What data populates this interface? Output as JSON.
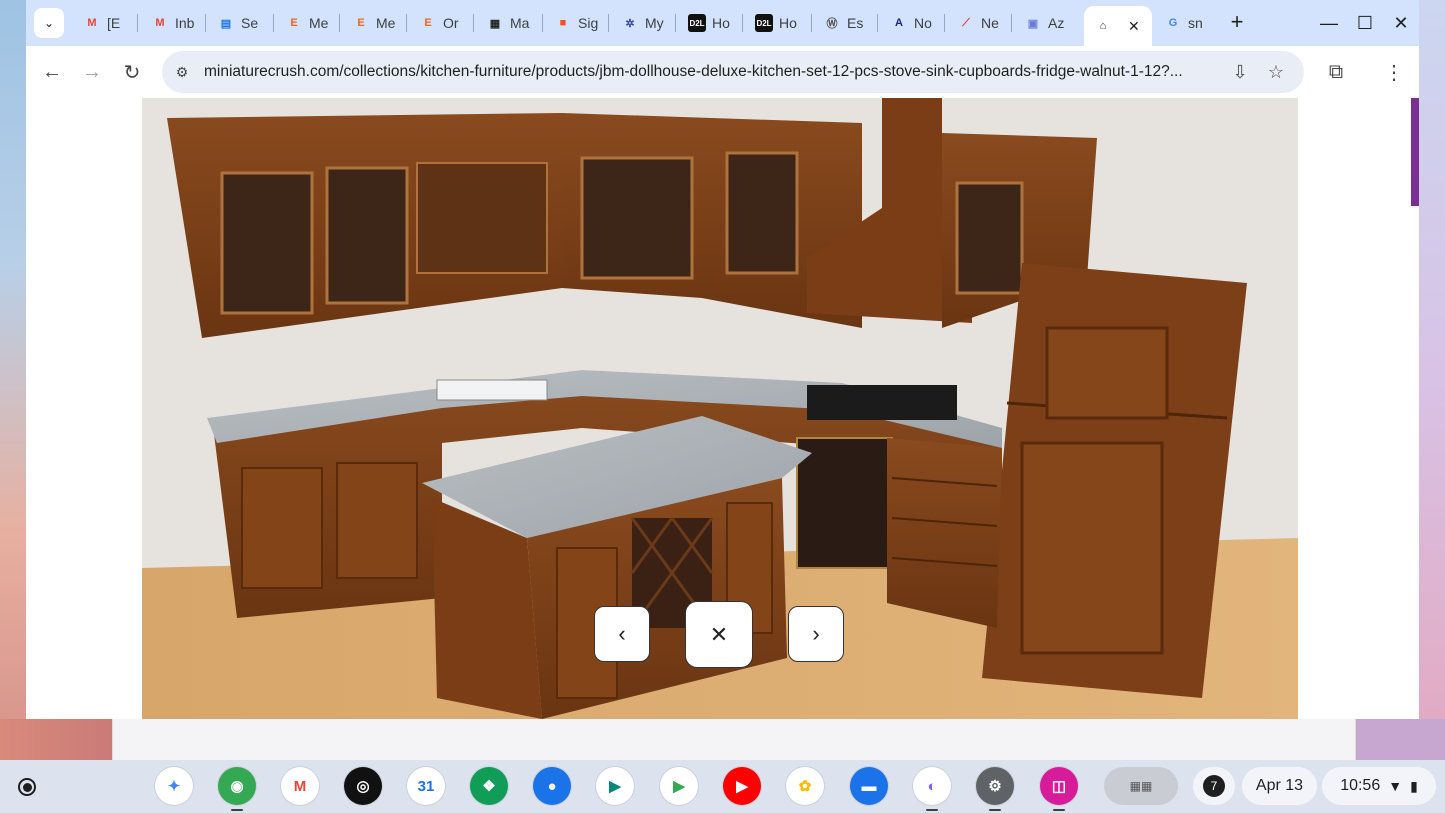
{
  "browser": {
    "tabs": [
      {
        "favicon": "gmail-icon",
        "label": "[E",
        "fav_color": "#ea4335"
      },
      {
        "favicon": "gmail-icon",
        "label": "Inb",
        "fav_color": "#ea4335"
      },
      {
        "favicon": "storefront-icon",
        "label": "Se",
        "fav_color": "#1a73e8"
      },
      {
        "favicon": "etsy-icon",
        "label": "Me",
        "fav_color": "#f1641e"
      },
      {
        "favicon": "etsy-icon",
        "label": "Me",
        "fav_color": "#f1641e"
      },
      {
        "favicon": "etsy-icon",
        "label": "Or",
        "fav_color": "#f1641e"
      },
      {
        "favicon": "colorful-store-icon",
        "label": "Ma",
        "fav_color": "#222222"
      },
      {
        "favicon": "microsoft-icon",
        "label": "Sig",
        "fav_color": "#f25022"
      },
      {
        "favicon": "pinwheel-icon",
        "label": "My",
        "fav_color": "#3949ab"
      },
      {
        "favicon": "d2l-icon",
        "label": "Ho",
        "fav_color": "#111111"
      },
      {
        "favicon": "d2l-icon",
        "label": "Ho",
        "fav_color": "#111111"
      },
      {
        "favicon": "signature-icon",
        "label": "Es",
        "fav_color": "#555555"
      },
      {
        "favicon": "letter-a-icon",
        "label": "No",
        "fav_color": "#1a237e"
      },
      {
        "favicon": "trend-icon",
        "label": "Ne",
        "fav_color": "#e53935"
      },
      {
        "favicon": "document-icon",
        "label": "Az",
        "fav_color": "#6b7dd8"
      },
      {
        "favicon": "house-icon",
        "label": "",
        "fav_color": "#333333",
        "active": true
      },
      {
        "favicon": "google-icon",
        "label": "sn",
        "fav_color": "#4285f4"
      }
    ],
    "fav_glyphs": [
      "M",
      "M",
      "▤",
      "E",
      "E",
      "E",
      "▦",
      "■",
      "✲",
      "D2L",
      "D2L",
      "Ⓦ",
      "A",
      "⟋",
      "▣",
      "⌂",
      "G"
    ],
    "new_tab": "+",
    "url": "miniaturecrush.com/collections/kitchen-furniture/products/jbm-dollhouse-deluxe-kitchen-set-12-pcs-stove-sink-cupboards-fridge-walnut-1-12?...",
    "accent": "#d3e3fd"
  },
  "gallery": {
    "prev": "‹",
    "close": "✕",
    "next": "›"
  },
  "shelf": {
    "apps": [
      {
        "name": "gemini-icon",
        "glyph": "✦",
        "bg": "#ffffff",
        "fg": "#4285f4"
      },
      {
        "name": "chrome-icon",
        "glyph": "◉",
        "bg": "#34a853",
        "fg": "#ffffff",
        "open": true
      },
      {
        "name": "gmail-icon",
        "glyph": "M",
        "bg": "#ffffff",
        "fg": "#ea4335"
      },
      {
        "name": "audiobook-icon",
        "glyph": "◎",
        "bg": "#111111",
        "fg": "#ffffff"
      },
      {
        "name": "calendar-icon",
        "glyph": "31",
        "bg": "#ffffff",
        "fg": "#1a73e8"
      },
      {
        "name": "app-grid-icon",
        "glyph": "❖",
        "bg": "#0f9d58",
        "fg": "#ffffff"
      },
      {
        "name": "messages-icon",
        "glyph": "●",
        "bg": "#1a73e8",
        "fg": "#ffffff"
      },
      {
        "name": "meet-icon",
        "glyph": "▶",
        "bg": "#ffffff",
        "fg": "#00897b"
      },
      {
        "name": "play-store-icon",
        "glyph": "▶",
        "bg": "#ffffff",
        "fg": "#34a853"
      },
      {
        "name": "youtube-icon",
        "glyph": "▶",
        "bg": "#ff0000",
        "fg": "#ffffff"
      },
      {
        "name": "photos-icon",
        "glyph": "✿",
        "bg": "#ffffff",
        "fg": "#fbbc04"
      },
      {
        "name": "files-icon",
        "glyph": "▬",
        "bg": "#1a73e8",
        "fg": "#ffffff"
      },
      {
        "name": "copilot-icon",
        "glyph": "◐",
        "bg": "#ffffff",
        "fg": "#7b61ff",
        "open": true
      },
      {
        "name": "settings-icon",
        "glyph": "⚙",
        "bg": "#5f6368",
        "fg": "#ffffff",
        "open": true
      },
      {
        "name": "screenshot-app-icon",
        "glyph": "◫",
        "bg": "#d81b9a",
        "fg": "#ffffff",
        "open": true
      }
    ],
    "notifications": "7",
    "date": "Apr 13",
    "time": "10:56"
  }
}
